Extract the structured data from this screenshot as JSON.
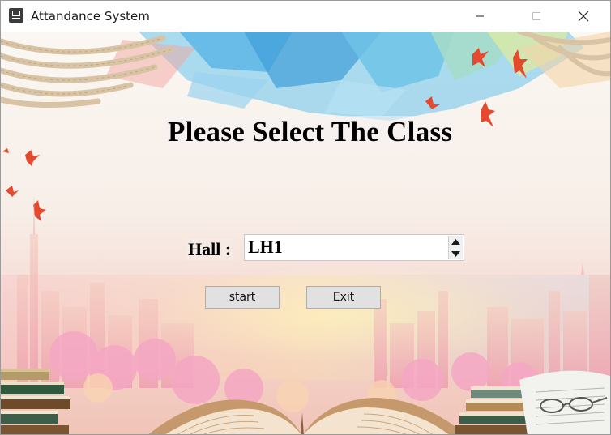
{
  "window": {
    "title": "Attandance System",
    "icons": {
      "app": "app-window-icon",
      "minimize": "minimize-icon",
      "maximize": "maximize-icon",
      "close": "close-icon"
    }
  },
  "main": {
    "heading": "Please Select The Class",
    "hall_label": "Hall :",
    "hall_value": "LH1",
    "start_label": "start",
    "exit_label": "Exit"
  },
  "colors": {
    "sky_blue": "#5fb6e6",
    "sky_teal": "#7fd6d0",
    "bird_red": "#e64a2e",
    "button_face": "#e1e1e1"
  }
}
